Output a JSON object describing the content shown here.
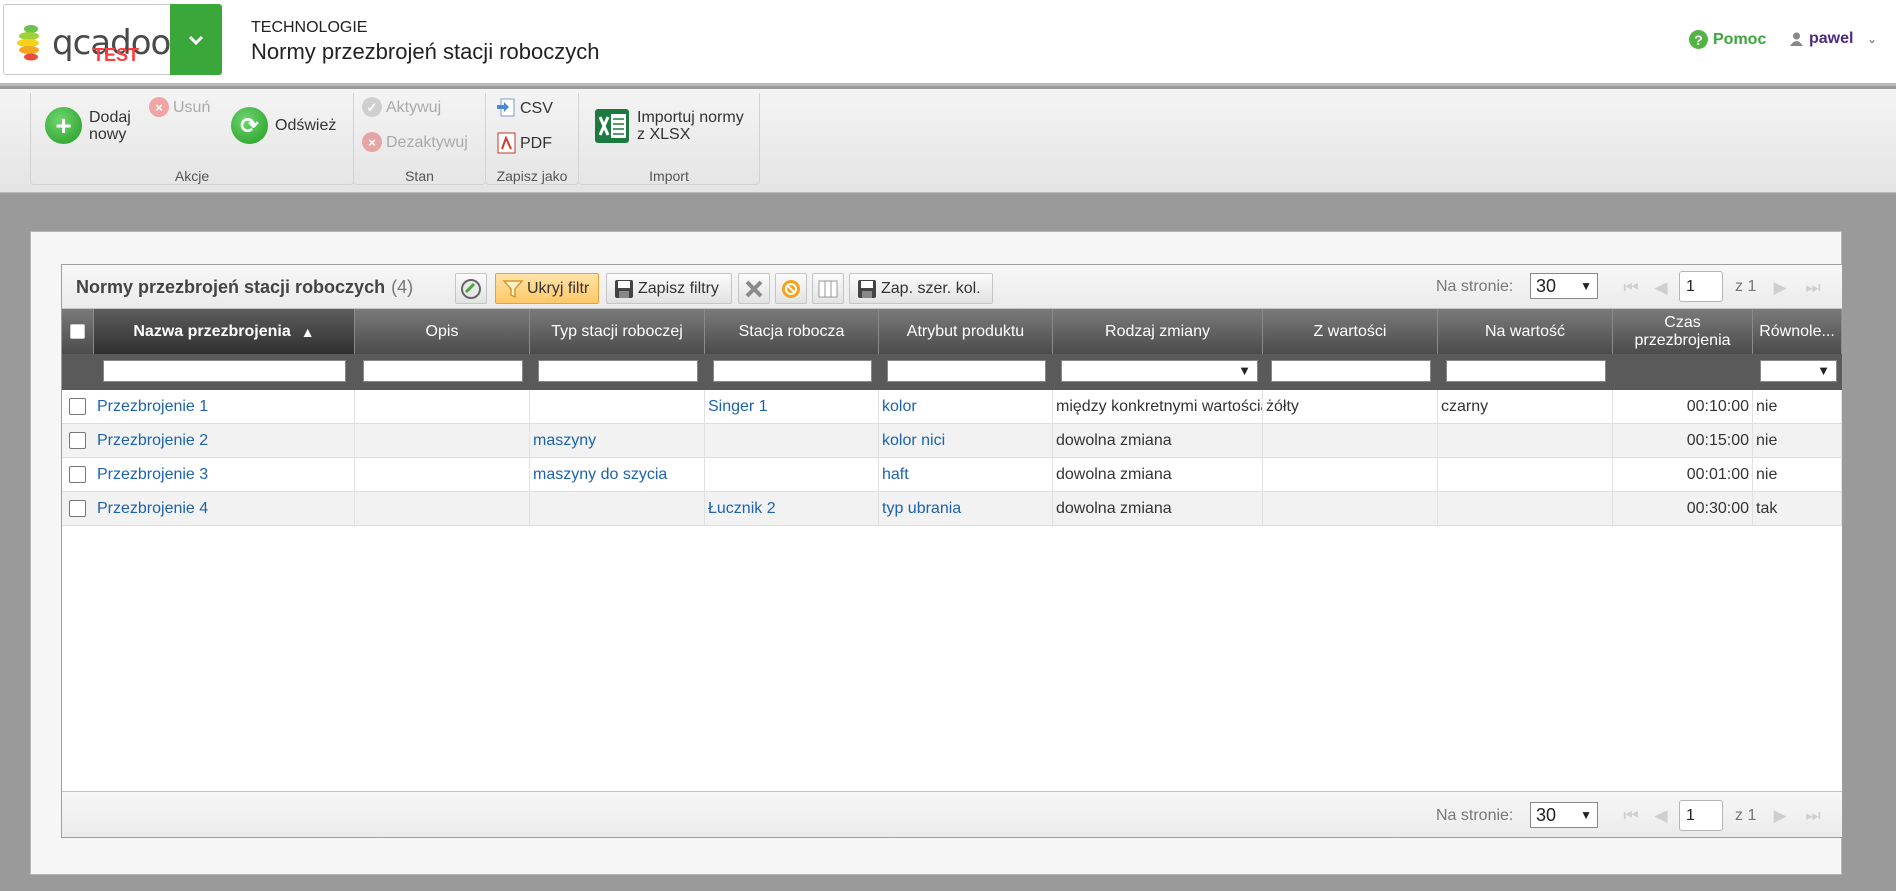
{
  "header": {
    "logo_text": "qcadoo",
    "logo_sub": "TEST",
    "section": "TECHNOLOGIE",
    "title": "Normy przezbrojeń stacji roboczych",
    "help_label": "Pomoc",
    "user_name": "pawel"
  },
  "ribbon": {
    "groups": {
      "actions": "Akcje",
      "state": "Stan",
      "save_as": "Zapisz jako",
      "import": "Import"
    },
    "add_new_line1": "Dodaj",
    "add_new_line2": "nowy",
    "delete": "Usuń",
    "refresh": "Odśwież",
    "activate": "Aktywuj",
    "deactivate": "Dezaktywuj",
    "csv": "CSV",
    "pdf": "PDF",
    "import_line1": "Importuj normy",
    "import_line2": "z XLSX"
  },
  "grid": {
    "title": "Normy przezbrojeń stacji roboczych",
    "count": "(4)",
    "hide_filter": "Ukryj filtr",
    "save_filters": "Zapisz filtry",
    "save_col_width": "Zap. szer. kol.",
    "per_page_label": "Na stronie:",
    "per_page_value": "30",
    "page": "1",
    "page_of": "z 1",
    "columns": [
      "Nazwa przezbrojenia",
      "Opis",
      "Typ stacji roboczej",
      "Stacja robocza",
      "Atrybut produktu",
      "Rodzaj zmiany",
      "Z wartości",
      "Na wartość",
      "Czas przezbrojenia",
      "Równole..."
    ],
    "rows": [
      {
        "name": "Przezbrojenie 1",
        "desc": "",
        "ws_type": "",
        "ws": "Singer 1",
        "attr": "kolor",
        "change": "między konkretnymi wartościami",
        "from": "żółty",
        "to": "czarny",
        "time": "00:10:00",
        "parallel": "nie"
      },
      {
        "name": "Przezbrojenie 2",
        "desc": "",
        "ws_type": "maszyny",
        "ws": "",
        "attr": "kolor nici",
        "change": "dowolna zmiana",
        "from": "",
        "to": "",
        "time": "00:15:00",
        "parallel": "nie"
      },
      {
        "name": "Przezbrojenie 3",
        "desc": "",
        "ws_type": "maszyny do szycia",
        "ws": "",
        "attr": "haft",
        "change": "dowolna zmiana",
        "from": "",
        "to": "",
        "time": "00:01:00",
        "parallel": "nie"
      },
      {
        "name": "Przezbrojenie 4",
        "desc": "",
        "ws_type": "",
        "ws": "Łucznik 2",
        "attr": "typ ubrania",
        "change": "dowolna zmiana",
        "from": "",
        "to": "",
        "time": "00:30:00",
        "parallel": "tak"
      }
    ]
  },
  "colors": {
    "brand_green": "#3aa73a",
    "link_blue": "#1d62ad",
    "user_purple": "#4b2a83",
    "logo_red": "#ff3b3b"
  }
}
